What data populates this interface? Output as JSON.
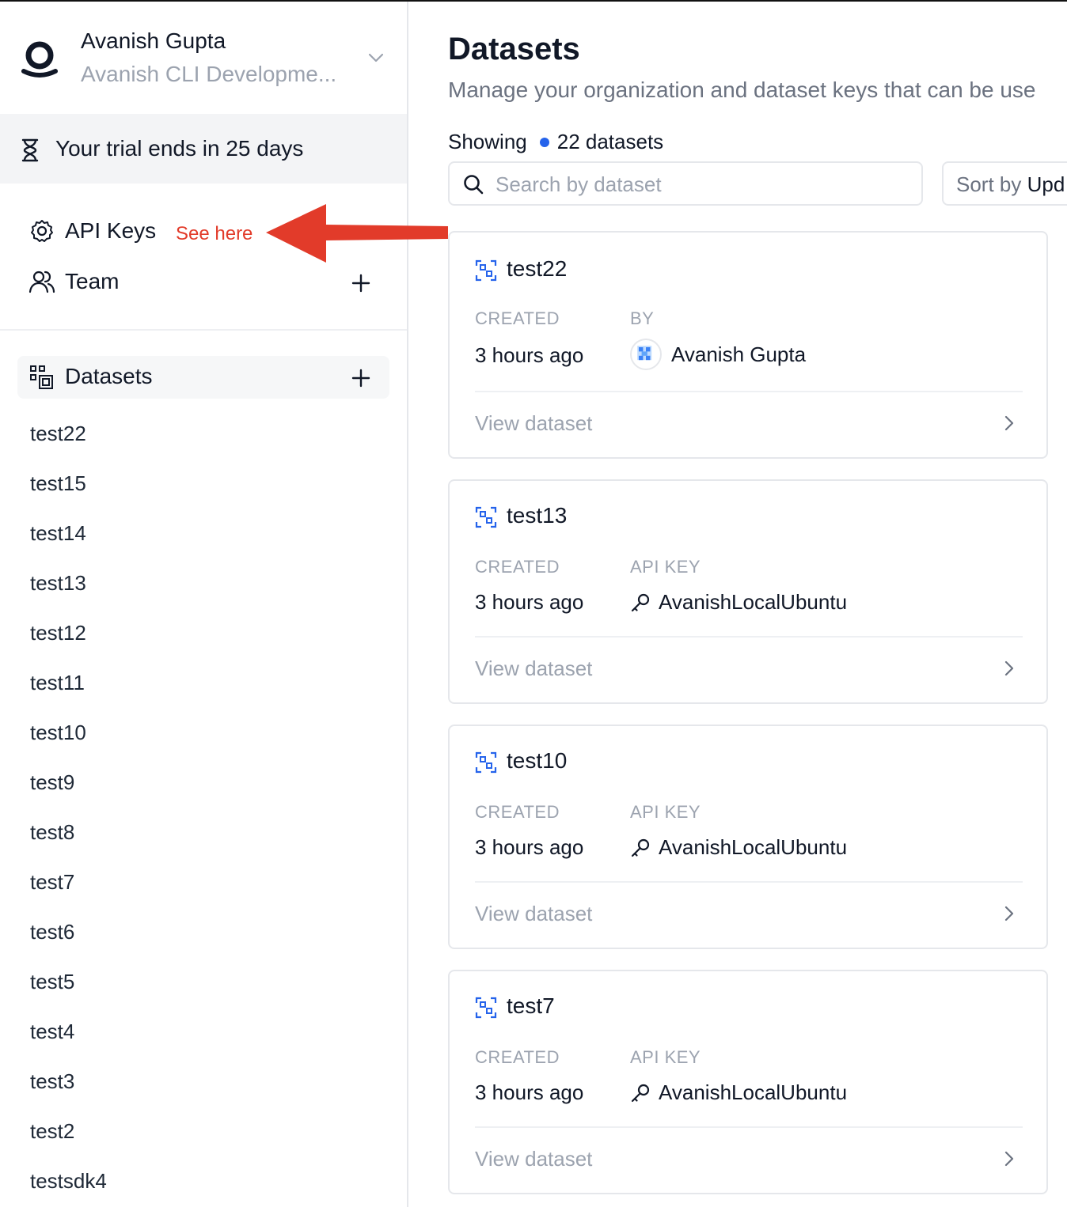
{
  "org": {
    "name": "Avanish Gupta",
    "subtitle": "Avanish CLI Developme..."
  },
  "trial": {
    "text": "Your trial ends in 25 days"
  },
  "nav": {
    "api_keys": "API Keys",
    "see_here": "See here",
    "team": "Team"
  },
  "datasets_section": {
    "label": "Datasets",
    "items": [
      "test22",
      "test15",
      "test14",
      "test13",
      "test12",
      "test11",
      "test10",
      "test9",
      "test8",
      "test7",
      "test6",
      "test5",
      "test4",
      "test3",
      "test2",
      "testsdk4"
    ]
  },
  "main": {
    "title": "Datasets",
    "subtitle": "Manage your organization and dataset keys that can be use",
    "showing_label": "Showing",
    "count_text": "22 datasets",
    "search_placeholder": "Search by dataset",
    "sort_prefix": "Sort by",
    "sort_value": "Upd"
  },
  "cards": [
    {
      "title": "test22",
      "created_label": "CREATED",
      "created_value": "3 hours ago",
      "second_label": "BY",
      "second_value": "Avanish Gupta",
      "view_label": "View dataset"
    },
    {
      "title": "test13",
      "created_label": "CREATED",
      "created_value": "3 hours ago",
      "second_label": "API KEY",
      "second_value": "AvanishLocalUbuntu",
      "view_label": "View dataset"
    },
    {
      "title": "test10",
      "created_label": "CREATED",
      "created_value": "3 hours ago",
      "second_label": "API KEY",
      "second_value": "AvanishLocalUbuntu",
      "view_label": "View dataset"
    },
    {
      "title": "test7",
      "created_label": "CREATED",
      "created_value": "3 hours ago",
      "second_label": "API KEY",
      "second_value": "AvanishLocalUbuntu",
      "view_label": "View dataset"
    }
  ],
  "colors": {
    "accent": "#2563eb",
    "annotation": "#e23b2a",
    "dataset_icon": "#2563eb"
  }
}
